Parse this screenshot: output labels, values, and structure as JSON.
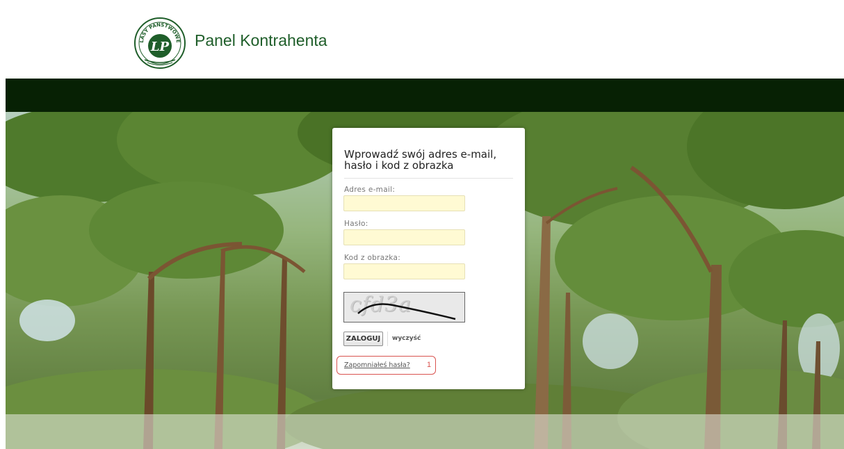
{
  "header": {
    "title": "Panel Kontrahenta",
    "logo_text": "LASY PAŃSTWOWE",
    "logo_mark": "LP"
  },
  "colors": {
    "brand_green": "#1f5e2a",
    "navbar": "#072104",
    "input_bg": "#fffad3",
    "annotation_red": "#d9534f"
  },
  "login": {
    "heading": "Wprowadź swój adres e-mail, hasło i kod z obrazka",
    "email_label": "Adres e-mail:",
    "email_value": "",
    "password_label": "Hasło:",
    "password_value": "",
    "captcha_label": "Kod z obrazka:",
    "captcha_value": "",
    "captcha_image_text": "cfd3a",
    "login_button": "ZALOGUJ",
    "clear_link": "wyczyść",
    "forgot_link": "Zapomniałeś hasła?",
    "annotation_number": "1"
  }
}
